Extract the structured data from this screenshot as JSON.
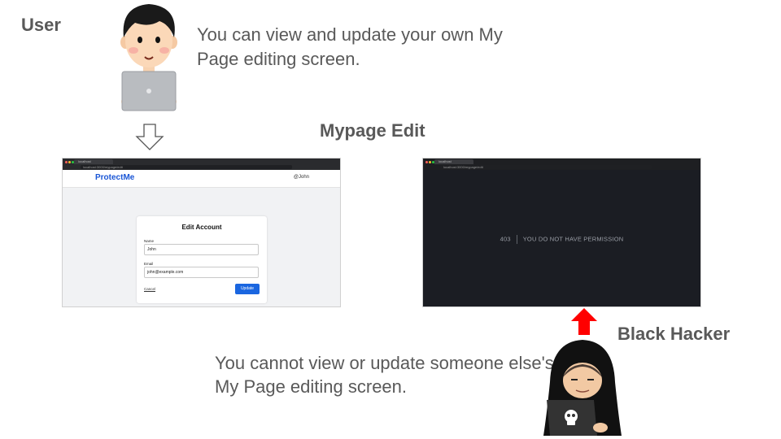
{
  "user": {
    "label": "User",
    "description": "You can view and update your own My Page editing screen."
  },
  "section_title": "Mypage Edit",
  "left_screenshot": {
    "browser_tab": "localhost",
    "url": "localhost:3000/mypage/edit",
    "brand": "ProtectMe",
    "user_handle": "@John",
    "form": {
      "title": "Edit Account",
      "name_label": "Name",
      "name_value": "John",
      "email_label": "Email",
      "email_value": "john@example.com",
      "cancel_label": "Cancel",
      "update_label": "Update"
    }
  },
  "right_screenshot": {
    "browser_tab": "localhost",
    "url": "localhost:3000/mypage/edit",
    "error_code": "403",
    "error_message": "YOU DO NOT HAVE PERMISSION"
  },
  "hacker": {
    "label": "Black Hacker",
    "description": "You cannot view or update someone else's My Page editing screen."
  },
  "colors": {
    "text": "#595959",
    "arrow_allowed": "#ffffff",
    "arrow_denied": "#ff0000",
    "brand": "#1a56d6",
    "update_button": "#1a66e0"
  }
}
